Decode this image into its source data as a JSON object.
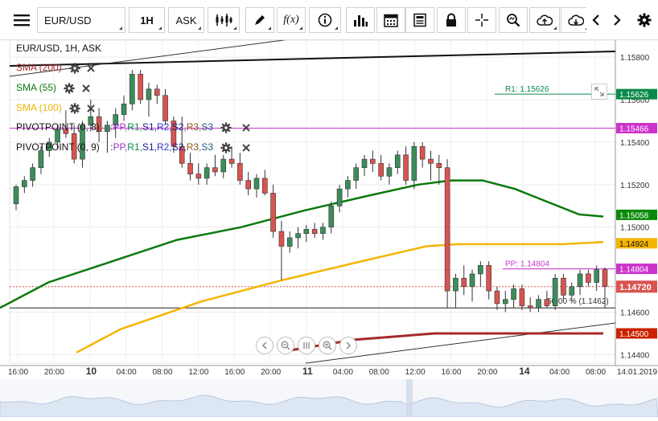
{
  "toolbar": {
    "symbol": "EUR/USD",
    "timeframe": "1H",
    "price_type": "ASK",
    "icons": [
      "menu-icon",
      "candlestick-icon",
      "pencil-icon",
      "function-icon",
      "info-icon",
      "bar-chart-icon",
      "calendar-icon",
      "document-icon",
      "lock-icon",
      "crosshair-icon",
      "zoom-icon",
      "upload-icon",
      "download-icon",
      "chevron-left-icon",
      "chevron-right-icon",
      "gear-icon"
    ]
  },
  "legend": {
    "title": "EUR/USD, 1H, ASK",
    "sma200": "SMA (200)",
    "sma55": "SMA (55)",
    "sma100": "SMA (100)",
    "pivot1": {
      "name": "PIVOTPOINT (0, 8)",
      "params": [
        ":",
        "PP,",
        "R1,",
        "S1,",
        "R2,",
        "S2,",
        "R3,",
        "S3"
      ]
    },
    "pivot2": {
      "name": "PIVOTPOINT (0, 9)",
      "params": [
        ":",
        "PP,",
        "R1,",
        "S1,",
        "R2,",
        "S2,",
        "R3,",
        "S3"
      ]
    },
    "pivot_colors": [
      "#333333",
      "#9933cc",
      "#0a8a4a",
      "#1a1a8a",
      "#3333cc",
      "#1a1a8a",
      "#8a5a1a",
      "#1a5a8a"
    ]
  },
  "chart_data": {
    "type": "candlestick",
    "symbol": "EUR/USD",
    "interval": "1H",
    "price_axis": {
      "ticks": [
        "1.15800",
        "1.15600",
        "1.15400",
        "1.15200",
        "1.15000",
        "1.14800",
        "1.14600",
        "1.14400"
      ],
      "range": [
        1.1436,
        1.1588
      ]
    },
    "time_axis": {
      "ticks": [
        "16:00",
        "20:00",
        "10",
        "04:00",
        "08:00",
        "12:00",
        "16:00",
        "20:00",
        "11",
        "04:00",
        "08:00",
        "12:00",
        "16:00",
        "20:00",
        "14",
        "04:00",
        "08:00",
        "14.01.2019"
      ]
    },
    "price_labels": [
      {
        "value": "1.15626",
        "color": "#0a8a4a"
      },
      {
        "value": "1.15466",
        "color": "#cc33cc"
      },
      {
        "value": "1.15058",
        "color": "#0a8a0a"
      },
      {
        "value": "1.14924",
        "color": "#f5b400"
      },
      {
        "value": "1.14804",
        "color": "#cc33cc"
      },
      {
        "value": "1.14720",
        "color": "#d9534f"
      },
      {
        "value": "1.14500",
        "color": "#cc2200"
      }
    ],
    "annotations": [
      {
        "text": "R1: 1.15626",
        "price": 1.15626,
        "color": "#0a8a4a"
      },
      {
        "text": "PP: 1.14804",
        "price": 1.14804,
        "color": "#cc33cc"
      },
      {
        "text": "50.00 % (1.1462)",
        "price": 1.1462,
        "color": "#333333"
      }
    ],
    "candles": [
      [
        1.1511,
        1.152,
        1.1508,
        1.1519
      ],
      [
        1.1519,
        1.1524,
        1.1516,
        1.1522
      ],
      [
        1.1522,
        1.153,
        1.1519,
        1.1528
      ],
      [
        1.1528,
        1.1538,
        1.1525,
        1.1536
      ],
      [
        1.1536,
        1.1542,
        1.1533,
        1.154
      ],
      [
        1.154,
        1.1548,
        1.1537,
        1.1546
      ],
      [
        1.1546,
        1.1555,
        1.1542,
        1.1544
      ],
      [
        1.1544,
        1.1548,
        1.153,
        1.1532
      ],
      [
        1.1532,
        1.155,
        1.1528,
        1.1548
      ],
      [
        1.1548,
        1.156,
        1.1545,
        1.1552
      ],
      [
        1.1552,
        1.1556,
        1.154,
        1.1545
      ],
      [
        1.1545,
        1.155,
        1.1535,
        1.1548
      ],
      [
        1.1548,
        1.1556,
        1.1542,
        1.1553
      ],
      [
        1.1553,
        1.1562,
        1.155,
        1.1558
      ],
      [
        1.1558,
        1.1574,
        1.1555,
        1.1572
      ],
      [
        1.1572,
        1.1574,
        1.1558,
        1.156
      ],
      [
        1.156,
        1.1568,
        1.1552,
        1.1565
      ],
      [
        1.1565,
        1.1567,
        1.1558,
        1.1562
      ],
      [
        1.1562,
        1.1565,
        1.1548,
        1.155
      ],
      [
        1.155,
        1.1552,
        1.1535,
        1.1538
      ],
      [
        1.1538,
        1.1552,
        1.1528,
        1.153
      ],
      [
        1.153,
        1.1535,
        1.1522,
        1.1525
      ],
      [
        1.1525,
        1.153,
        1.152,
        1.1523
      ],
      [
        1.1523,
        1.153,
        1.152,
        1.1528
      ],
      [
        1.1528,
        1.1534,
        1.1524,
        1.1526
      ],
      [
        1.1526,
        1.1534,
        1.1523,
        1.1532
      ],
      [
        1.1532,
        1.1538,
        1.1528,
        1.153
      ],
      [
        1.153,
        1.1535,
        1.152,
        1.1522
      ],
      [
        1.1522,
        1.1526,
        1.1515,
        1.1518
      ],
      [
        1.1518,
        1.1525,
        1.1514,
        1.1523
      ],
      [
        1.1523,
        1.1527,
        1.1515,
        1.1516
      ],
      [
        1.1516,
        1.152,
        1.1495,
        1.1498
      ],
      [
        1.1498,
        1.1503,
        1.1475,
        1.1491
      ],
      [
        1.1491,
        1.1498,
        1.1488,
        1.1495
      ],
      [
        1.1495,
        1.15,
        1.149,
        1.1497
      ],
      [
        1.1497,
        1.1501,
        1.1493,
        1.1499
      ],
      [
        1.1499,
        1.1502,
        1.1495,
        1.1497
      ],
      [
        1.1497,
        1.1502,
        1.1494,
        1.15
      ],
      [
        1.15,
        1.1512,
        1.1497,
        1.151
      ],
      [
        1.151,
        1.152,
        1.1507,
        1.1518
      ],
      [
        1.1518,
        1.1524,
        1.1514,
        1.1522
      ],
      [
        1.1522,
        1.153,
        1.1518,
        1.1528
      ],
      [
        1.1528,
        1.1534,
        1.1524,
        1.1532
      ],
      [
        1.1532,
        1.1536,
        1.1526,
        1.153
      ],
      [
        1.153,
        1.1534,
        1.1522,
        1.1524
      ],
      [
        1.1524,
        1.153,
        1.152,
        1.1528
      ],
      [
        1.1528,
        1.1536,
        1.1525,
        1.1534
      ],
      [
        1.1534,
        1.1538,
        1.152,
        1.1522
      ],
      [
        1.1522,
        1.154,
        1.1518,
        1.1538
      ],
      [
        1.1538,
        1.154,
        1.1528,
        1.1532
      ],
      [
        1.1532,
        1.1536,
        1.1522,
        1.153
      ],
      [
        1.153,
        1.1534,
        1.152,
        1.1528
      ],
      [
        1.1528,
        1.1532,
        1.1462,
        1.147
      ],
      [
        1.147,
        1.1478,
        1.1462,
        1.1476
      ],
      [
        1.1476,
        1.1482,
        1.1468,
        1.1472
      ],
      [
        1.1472,
        1.148,
        1.1465,
        1.1478
      ],
      [
        1.1478,
        1.1484,
        1.1472,
        1.1482
      ],
      [
        1.1482,
        1.1484,
        1.1466,
        1.147
      ],
      [
        1.147,
        1.1472,
        1.1461,
        1.1464
      ],
      [
        1.1464,
        1.147,
        1.146,
        1.1466
      ],
      [
        1.1466,
        1.1473,
        1.1462,
        1.1471
      ],
      [
        1.1471,
        1.1473,
        1.1461,
        1.1463
      ],
      [
        1.1463,
        1.1467,
        1.146,
        1.1462
      ],
      [
        1.1462,
        1.1468,
        1.146,
        1.1466
      ],
      [
        1.1466,
        1.147,
        1.1462,
        1.1463
      ],
      [
        1.1463,
        1.1478,
        1.1461,
        1.1476
      ],
      [
        1.1476,
        1.1478,
        1.1466,
        1.1468
      ],
      [
        1.1468,
        1.1474,
        1.1465,
        1.1472
      ],
      [
        1.1472,
        1.148,
        1.1468,
        1.1478
      ],
      [
        1.1478,
        1.148,
        1.1472,
        1.1474
      ],
      [
        1.1474,
        1.1482,
        1.147,
        1.148
      ],
      [
        1.148,
        1.1481,
        1.1462,
        1.1472
      ]
    ],
    "sma55": [
      [
        0,
        1.1462
      ],
      [
        60,
        1.1474
      ],
      [
        140,
        1.1484
      ],
      [
        220,
        1.1494
      ],
      [
        300,
        1.15
      ],
      [
        380,
        1.1508
      ],
      [
        460,
        1.1515
      ],
      [
        520,
        1.152
      ],
      [
        560,
        1.1522
      ],
      [
        600,
        1.1522
      ],
      [
        640,
        1.1518
      ],
      [
        680,
        1.1512
      ],
      [
        720,
        1.1506
      ],
      [
        750,
        1.1505
      ]
    ],
    "sma100": [
      [
        95,
        1.1441
      ],
      [
        150,
        1.1452
      ],
      [
        250,
        1.1465
      ],
      [
        350,
        1.1475
      ],
      [
        450,
        1.1484
      ],
      [
        530,
        1.1491
      ],
      [
        570,
        1.1492
      ],
      [
        650,
        1.1492
      ],
      [
        700,
        1.1492
      ],
      [
        750,
        1.1493
      ]
    ],
    "sma200": [
      [
        360,
        1.1442
      ],
      [
        440,
        1.1447
      ],
      [
        540,
        1.145
      ],
      [
        620,
        1.145
      ],
      [
        700,
        1.145
      ],
      [
        750,
        1.145
      ]
    ]
  },
  "nav": {
    "buttons": [
      "chevron-left-icon",
      "zoom-out-icon",
      "pause-icon",
      "zoom-in-icon",
      "chevron-right-icon"
    ]
  }
}
